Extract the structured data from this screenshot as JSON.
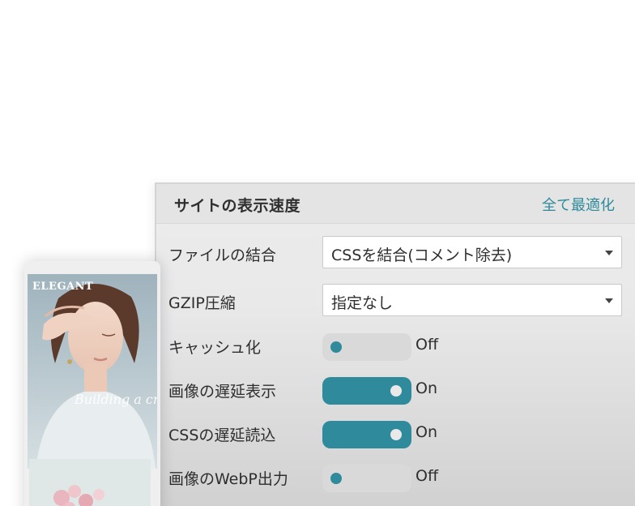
{
  "panel": {
    "title": "サイトの表示速度",
    "optimize_all_label": "全て最適化"
  },
  "settings": {
    "combine_files": {
      "label": "ファイルの結合",
      "value": "CSSを結合(コメント除去)"
    },
    "gzip": {
      "label": "GZIP圧縮",
      "value": "指定なし"
    },
    "cache": {
      "label": "キャッシュ化",
      "state": "Off"
    },
    "lazy_images": {
      "label": "画像の遅延表示",
      "state": "On"
    },
    "lazy_css": {
      "label": "CSSの遅延読込",
      "state": "On"
    },
    "webp": {
      "label": "画像のWebP出力",
      "state": "Off"
    }
  },
  "preview": {
    "logo": "ELEGANT",
    "script_text": "Building a creative space"
  },
  "colors": {
    "accent": "#2f8a9b",
    "toggle_off_track": "#d9d9d9",
    "panel_header_bg": "#e4e4e4",
    "text": "#2e2e2e"
  }
}
